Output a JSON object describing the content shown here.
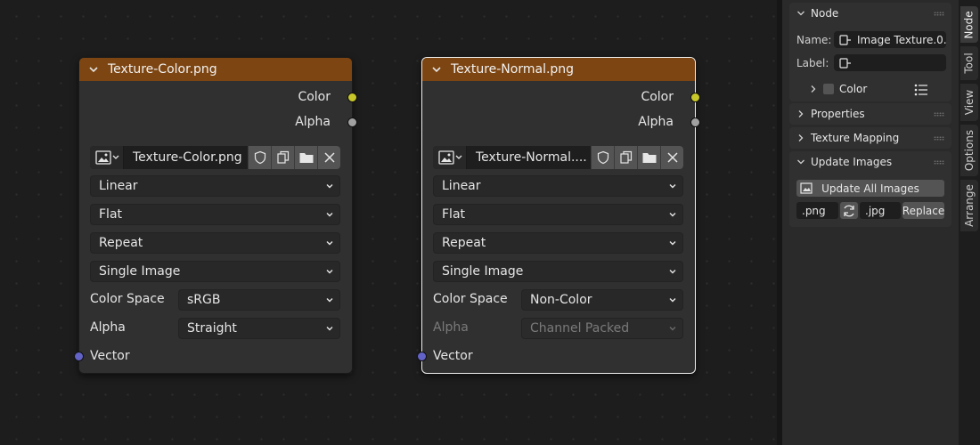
{
  "nodes": [
    {
      "title": "Texture-Color.png",
      "outputs": {
        "color": "Color",
        "alpha": "Alpha"
      },
      "image_name": "Texture-Color.png",
      "interpolation": "Linear",
      "projection": "Flat",
      "extension": "Repeat",
      "source": "Single Image",
      "color_space_label": "Color Space",
      "color_space": "sRGB",
      "alpha_label": "Alpha",
      "alpha_mode": "Straight",
      "vector_label": "Vector"
    },
    {
      "title": "Texture-Normal.png",
      "outputs": {
        "color": "Color",
        "alpha": "Alpha"
      },
      "image_name": "Texture-Normal....",
      "interpolation": "Linear",
      "projection": "Flat",
      "extension": "Repeat",
      "source": "Single Image",
      "color_space_label": "Color Space",
      "color_space": "Non-Color",
      "alpha_label": "Alpha",
      "alpha_mode": "Channel Packed",
      "vector_label": "Vector"
    }
  ],
  "sidebar": {
    "node_panel": {
      "title": "Node",
      "name_label": "Name:",
      "name_value": "Image Texture.0...",
      "label_label": "Label:",
      "label_value": "",
      "color_label": "Color"
    },
    "properties_title": "Properties",
    "texture_mapping_title": "Texture Mapping",
    "update_images": {
      "title": "Update Images",
      "update_all_label": "Update All Images",
      "from_ext": ".png",
      "to_ext": ".jpg",
      "replace_label": "Replace"
    }
  },
  "tabs": [
    "Node",
    "Tool",
    "View",
    "Options",
    "Arrange"
  ],
  "colors": {
    "header": "#7d4511",
    "socket_color": "#c7c729",
    "socket_alpha": "#a1a1a1",
    "socket_vector": "#6363c7"
  }
}
